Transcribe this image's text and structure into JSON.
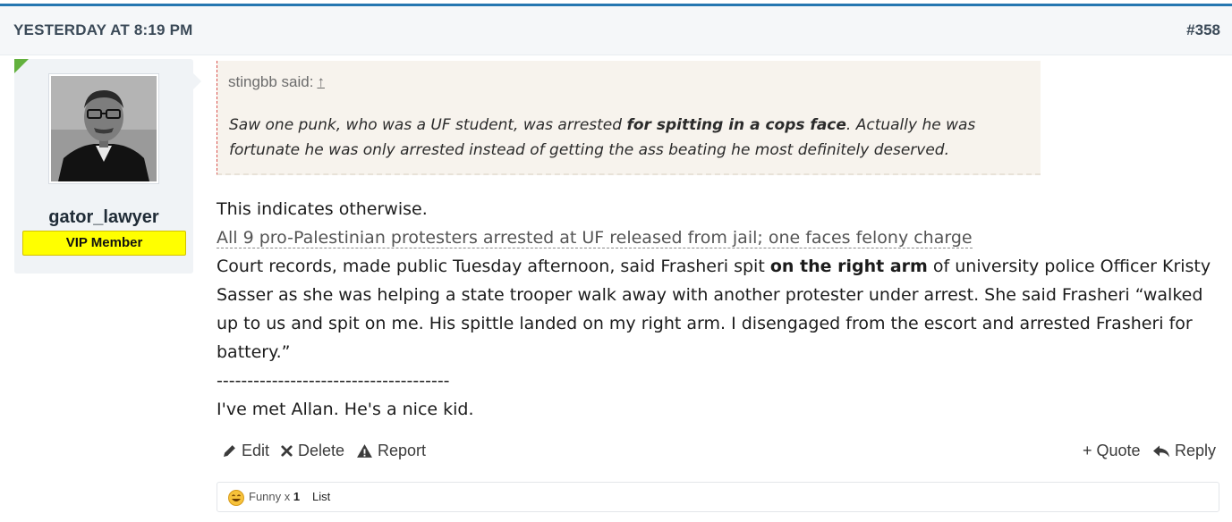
{
  "header": {
    "date": "YESTERDAY AT 8:19 PM",
    "post_number": "#358"
  },
  "user": {
    "username": "gator_lawyer",
    "badge": "VIP Member"
  },
  "quote": {
    "attribution": "stingbb said:",
    "jump_glyph": "↑",
    "text_before": "Saw one punk, who was a UF student, was arrested ",
    "text_bold": "for spitting in a cops face",
    "text_after": ". Actually he was fortunate he was only arrested instead of getting the ass beating he most definitely deserved."
  },
  "body": {
    "line1": "This indicates otherwise.",
    "link_text": "All 9 pro-Palestinian protesters arrested at UF released from jail; one faces felony charge",
    "para_before": "Court records, made public Tuesday afternoon, said Frasheri spit ",
    "para_bold": "on the right arm",
    "para_after": " of university police Officer Kristy Sasser as she was helping a state trooper walk away with another protester under arrest. She said Frasheri “walked up to us and spit on me. His spittle landed on my right arm. I disengaged from the escort and arrested Frasheri for battery.”",
    "divider": "--------------------------------------",
    "closing": "I've met Allan. He's a nice kid."
  },
  "actions": {
    "edit": "Edit",
    "delete": "Delete",
    "report": "Report",
    "quote": "+ Quote",
    "reply": "Reply"
  },
  "reactions": {
    "label": "Funny x ",
    "count": "1",
    "list": "List"
  },
  "colors": {
    "accent": "#2577b1",
    "badge_bg": "#ffff00",
    "online_marker": "#63b13e"
  }
}
